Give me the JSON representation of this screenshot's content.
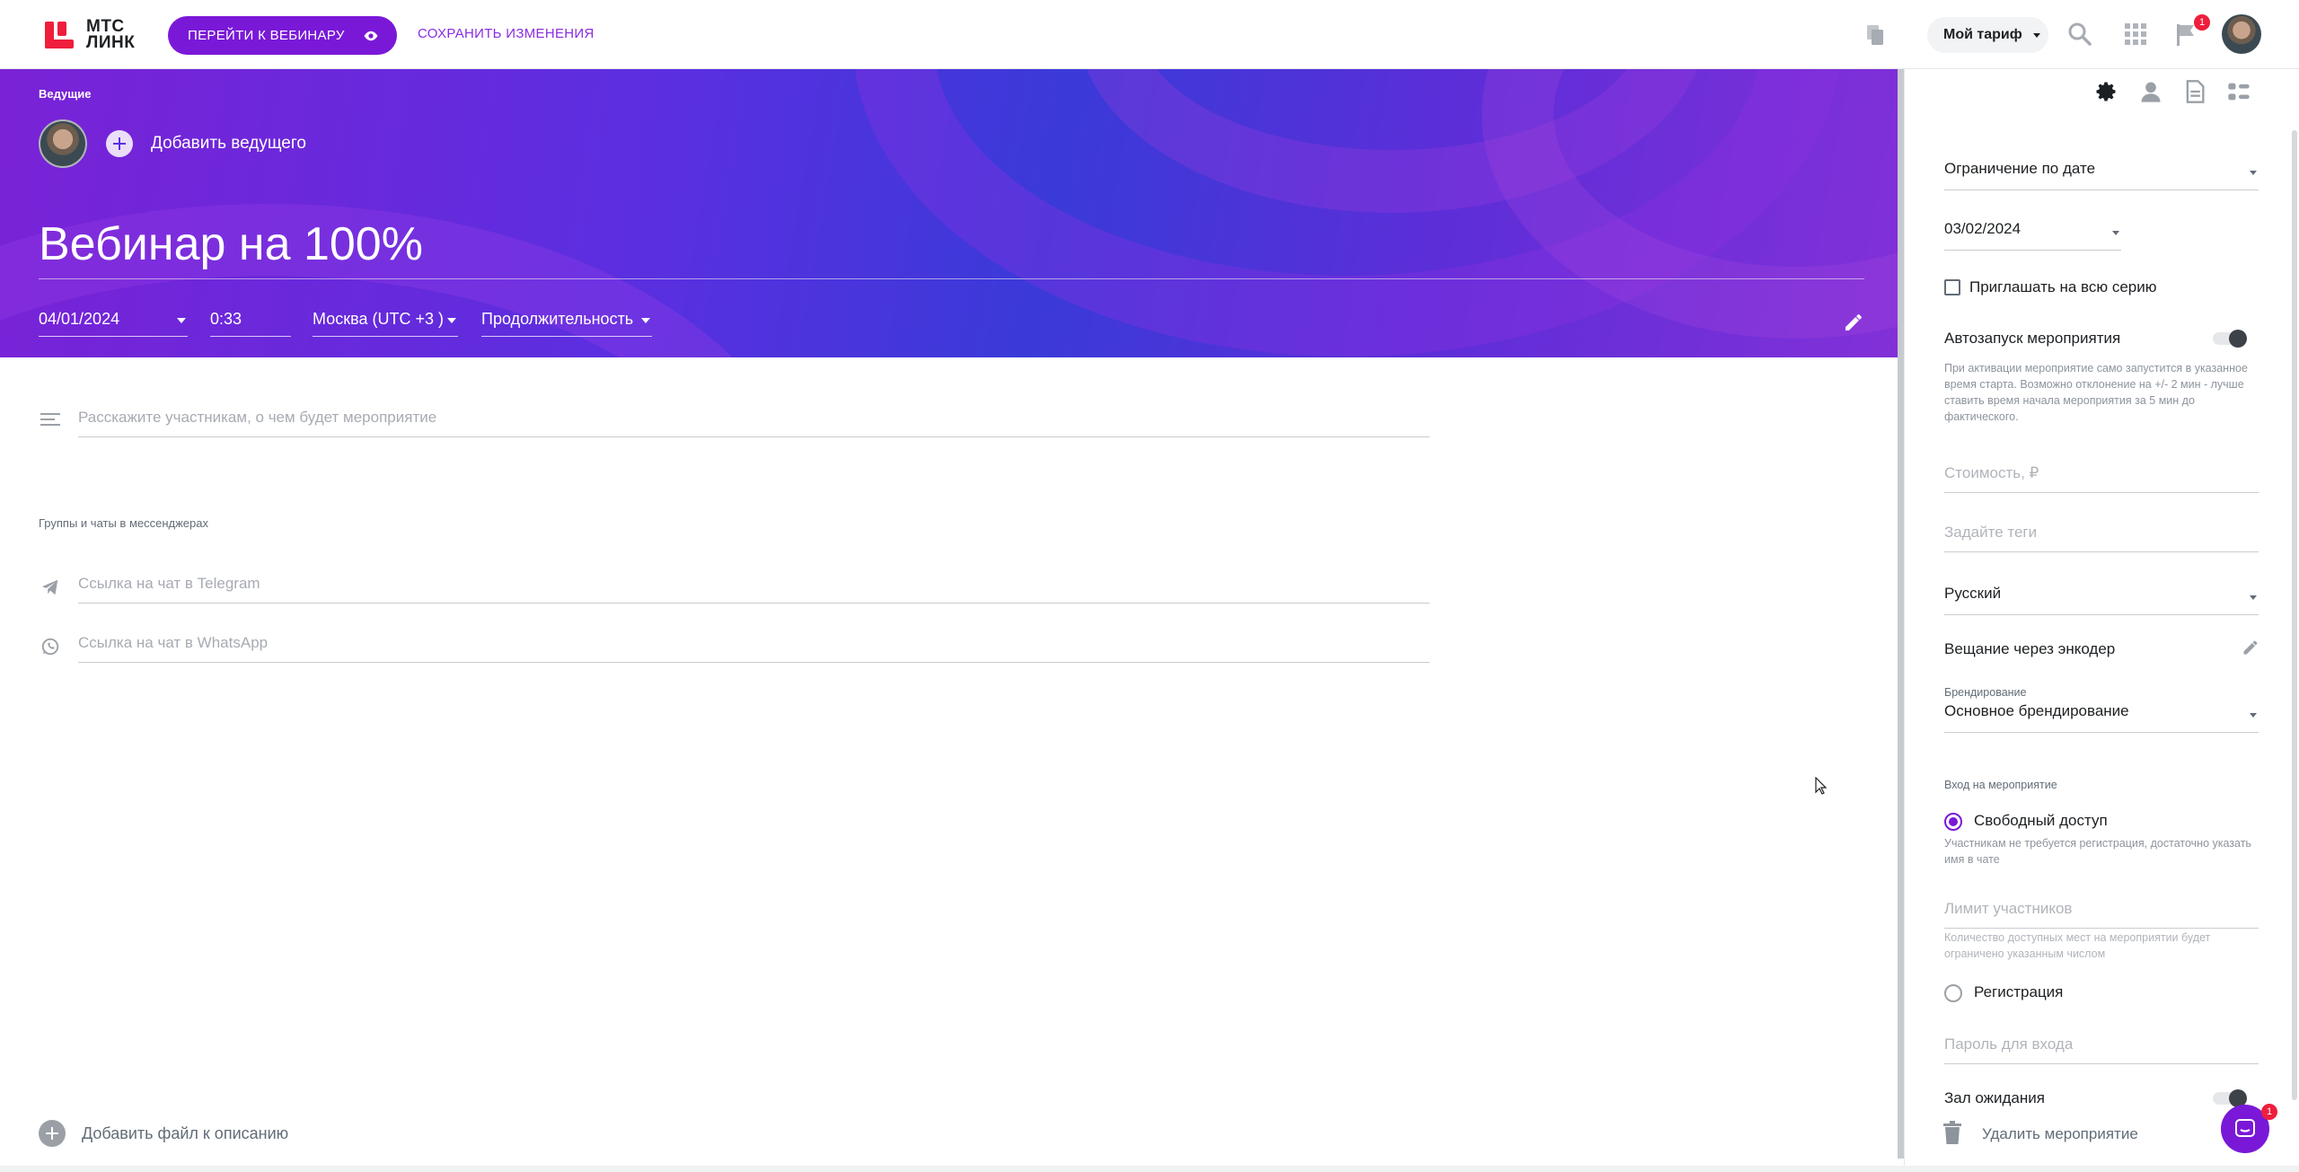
{
  "logo": {
    "line1": "МТС",
    "line2": "ЛИНК"
  },
  "topbar": {
    "go_to_webinar": "ПЕРЕЙТИ К ВЕБИНАРУ",
    "save_changes": "СОХРАНИТЬ ИЗМЕНЕНИЯ",
    "tariff": "Мой тариф",
    "notification_count": "1",
    "icons": [
      "copy-icon",
      "search-icon",
      "apps-grid-icon",
      "flag-icon",
      "avatar"
    ]
  },
  "hero": {
    "hosts_label": "Ведущие",
    "add_host": "Добавить ведущего",
    "title": "Вебинар на 100%",
    "date": "04/01/2024",
    "time": "0:33",
    "timezone": "Москва (UTC +3 )",
    "duration": "Продолжительность"
  },
  "main": {
    "description_placeholder": "Расскажите участникам, о чем будет мероприятие",
    "groups_label": "Группы и чаты в мессенджерах",
    "telegram_placeholder": "Ссылка на чат в Telegram",
    "whatsapp_placeholder": "Ссылка на чат в WhatsApp",
    "add_file": "Добавить файл к описанию"
  },
  "panel": {
    "tabs": [
      "settings-gear-icon",
      "participant-icon",
      "document-icon",
      "list-icon"
    ],
    "date_limit": "Ограничение по дате",
    "limit_date": "03/02/2024",
    "invite_series": "Приглашать на всю серию",
    "autostart": "Автозапуск мероприятия",
    "autostart_hint": "При активации мероприятие само запустится в указанное время старта. Возможно отклонение на +/- 2 мин - лучше ставить время начала мероприятия за 5 мин до фактического.",
    "price_placeholder": "Стоимость, ₽",
    "tags_placeholder": "Задайте теги",
    "language": "Русский",
    "encoder": "Вещание через энкодер",
    "branding_label": "Брендирование",
    "branding": "Основное брендирование",
    "entry_label": "Вход на мероприятие",
    "free_access": "Свободный доступ",
    "free_access_hint": "Участникам не требуется регистрация, достаточно указать имя в чате",
    "participants_limit_placeholder": "Лимит участников",
    "participants_limit_hint": "Количество доступных мест на мероприятии будет ограничено указанным числом",
    "registration": "Регистрация",
    "password_placeholder": "Пароль для входа",
    "waiting_room": "Зал ожидания",
    "delete_event": "Удалить мероприятие",
    "chat_badge": "1"
  },
  "colors": {
    "accent": "#7a18d8",
    "brand_red": "#ee1e3c"
  }
}
